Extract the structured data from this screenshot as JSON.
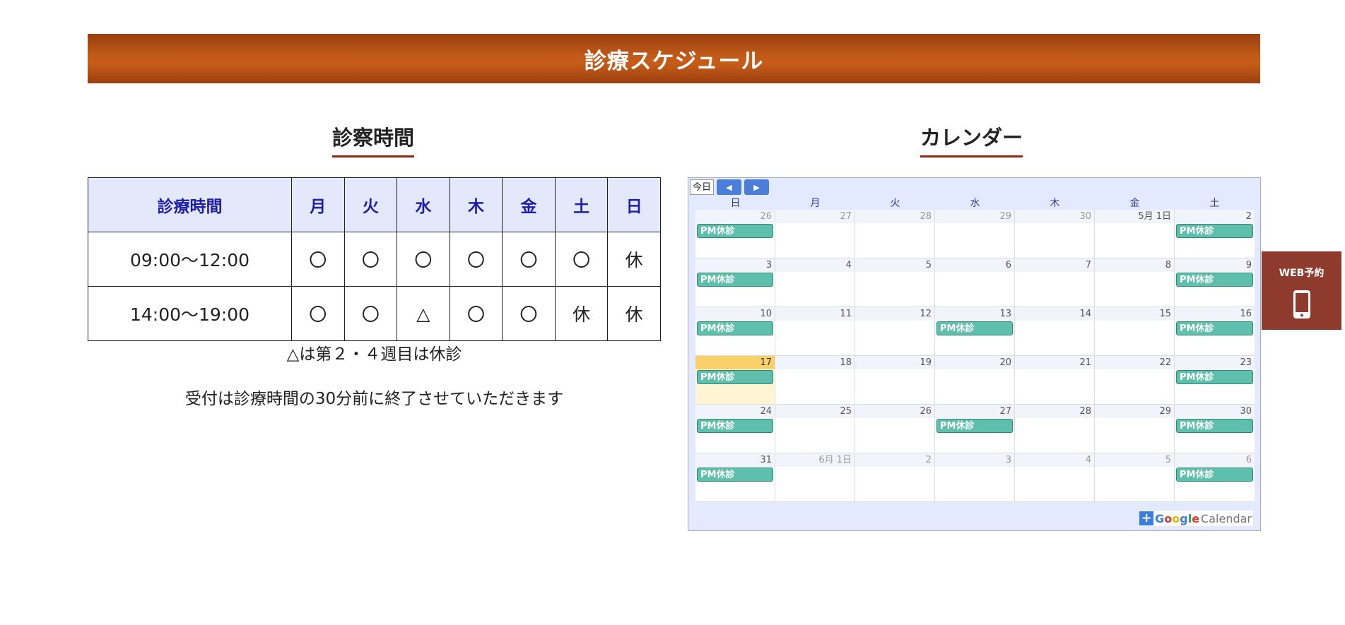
{
  "banner": {
    "title": "診療スケジュール"
  },
  "sections": {
    "hours_title": "診察時間",
    "calendar_title": "カレンダー"
  },
  "hours_table": {
    "headers": [
      "診療時間",
      "月",
      "火",
      "水",
      "木",
      "金",
      "土",
      "日"
    ],
    "rows": [
      [
        "09:00～12:00",
        "〇",
        "〇",
        "〇",
        "〇",
        "〇",
        "〇",
        "休"
      ],
      [
        "14:00～19:00",
        "〇",
        "〇",
        "△",
        "〇",
        "〇",
        "休",
        "休"
      ]
    ]
  },
  "notes": {
    "line1": "△は第２・４週目は休診",
    "line2": "受付は診療時間の30分前に終了させていただきます"
  },
  "calendar": {
    "today_button": "今日",
    "prev_icon": "triangle-left-icon",
    "next_icon": "triangle-right-icon",
    "weekdays": [
      "日",
      "月",
      "火",
      "水",
      "木",
      "金",
      "土"
    ],
    "event_label": "PM休診",
    "weeks": [
      [
        {
          "n": "26",
          "other": true,
          "evt": true
        },
        {
          "n": "27",
          "other": true
        },
        {
          "n": "28",
          "other": true
        },
        {
          "n": "29",
          "other": true
        },
        {
          "n": "30",
          "other": true
        },
        {
          "n": "5月 1日"
        },
        {
          "n": "2",
          "evt": true
        }
      ],
      [
        {
          "n": "3",
          "evt": true
        },
        {
          "n": "4"
        },
        {
          "n": "5"
        },
        {
          "n": "6"
        },
        {
          "n": "7"
        },
        {
          "n": "8"
        },
        {
          "n": "9",
          "evt": true
        }
      ],
      [
        {
          "n": "10",
          "evt": true
        },
        {
          "n": "11"
        },
        {
          "n": "12"
        },
        {
          "n": "13",
          "evt": true
        },
        {
          "n": "14"
        },
        {
          "n": "15"
        },
        {
          "n": "16",
          "evt": true
        }
      ],
      [
        {
          "n": "17",
          "evt": true,
          "today": true
        },
        {
          "n": "18"
        },
        {
          "n": "19"
        },
        {
          "n": "20"
        },
        {
          "n": "21"
        },
        {
          "n": "22"
        },
        {
          "n": "23",
          "evt": true
        }
      ],
      [
        {
          "n": "24",
          "evt": true
        },
        {
          "n": "25"
        },
        {
          "n": "26"
        },
        {
          "n": "27",
          "evt": true
        },
        {
          "n": "28"
        },
        {
          "n": "29"
        },
        {
          "n": "30",
          "evt": true
        }
      ],
      [
        {
          "n": "31",
          "evt": true
        },
        {
          "n": "6月 1日",
          "other": true
        },
        {
          "n": "2",
          "other": true
        },
        {
          "n": "3",
          "other": true
        },
        {
          "n": "4",
          "other": true
        },
        {
          "n": "5",
          "other": true
        },
        {
          "n": "6",
          "other": true,
          "evt": true
        }
      ]
    ],
    "footer": {
      "google": "Google",
      "calendar": "Calendar",
      "plus_icon": "plus-icon"
    }
  },
  "web_reservation": {
    "label": "WEB予約",
    "icon": "smartphone-icon"
  },
  "colors": {
    "banner": "#c15a18",
    "accent_underline": "#8b2a12",
    "event": "#5fbfad",
    "web_button": "#8e3a2c"
  }
}
